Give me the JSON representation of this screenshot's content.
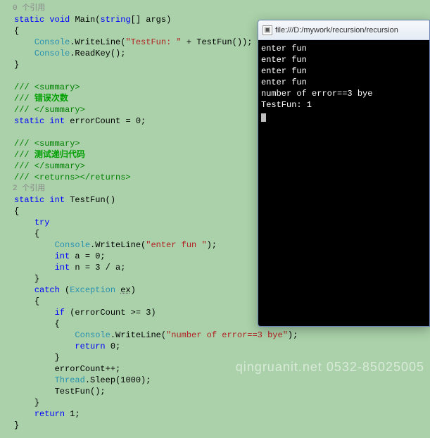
{
  "refs": {
    "main": "0 个引用",
    "testfun": "2 个引用"
  },
  "code": {
    "l1_static": "static",
    "l1_void": "void",
    "l1_main": "Main",
    "l1_string": "string",
    "l1_args": "[] args)",
    "l2": "{",
    "l3_console": "Console",
    "l3_write": ".WriteLine(",
    "l3_str": "\"TestFun: \"",
    "l3_rest": " + TestFun());",
    "l4_console": "Console",
    "l4_read": ".ReadKey();",
    "l5": "}",
    "sum_open": "/// <summary>",
    "sum_err": "错误次数",
    "sum_close": "/// </summary>",
    "err_static": "static",
    "err_int": "int",
    "err_rest": " errorCount = 0;",
    "sum_test": "测试递归代码",
    "ret_open": "/// <returns></returns>",
    "tf_static": "static",
    "tf_int": "int",
    "tf_name": " TestFun()",
    "tf_open": "{",
    "try": "try",
    "try_open": "{",
    "tfl1_console": "Console",
    "tfl1_write": ".WriteLine(",
    "tfl1_str": "\"enter fun \"",
    "tfl1_end": ");",
    "tfl2_int": "int",
    "tfl2_rest": " a = 0;",
    "tfl3_int": "int",
    "tfl3_rest": " n = 3 / a;",
    "try_close": "}",
    "catch": "catch",
    "catch_exc": "Exception",
    "catch_ex": "ex",
    "catch_paren": ")",
    "catch_open": "{",
    "if": "if",
    "if_cond": " (errorCount >= 3)",
    "if_open": "{",
    "ifbody_console": "Console",
    "ifbody_write": ".WriteLine(",
    "ifbody_str": "\"number of error==3 bye\"",
    "ifbody_end": ");",
    "return0": "return",
    "return0_rest": " 0;",
    "if_close": "}",
    "inc": "errorCount++;",
    "thread": "Thread",
    "sleep": ".Sleep(1000);",
    "recurse": "TestFun();",
    "catch_close": "}",
    "return1": "return",
    "return1_rest": " 1;",
    "tf_close": "}"
  },
  "console": {
    "title": "file:///D:/mywork/recursion/recursion",
    "lines": [
      "enter fun",
      "enter fun",
      "enter fun",
      "enter fun",
      "number of error==3 bye",
      "TestFun: 1"
    ]
  },
  "watermark": "qingruanit.net 0532-85025005"
}
